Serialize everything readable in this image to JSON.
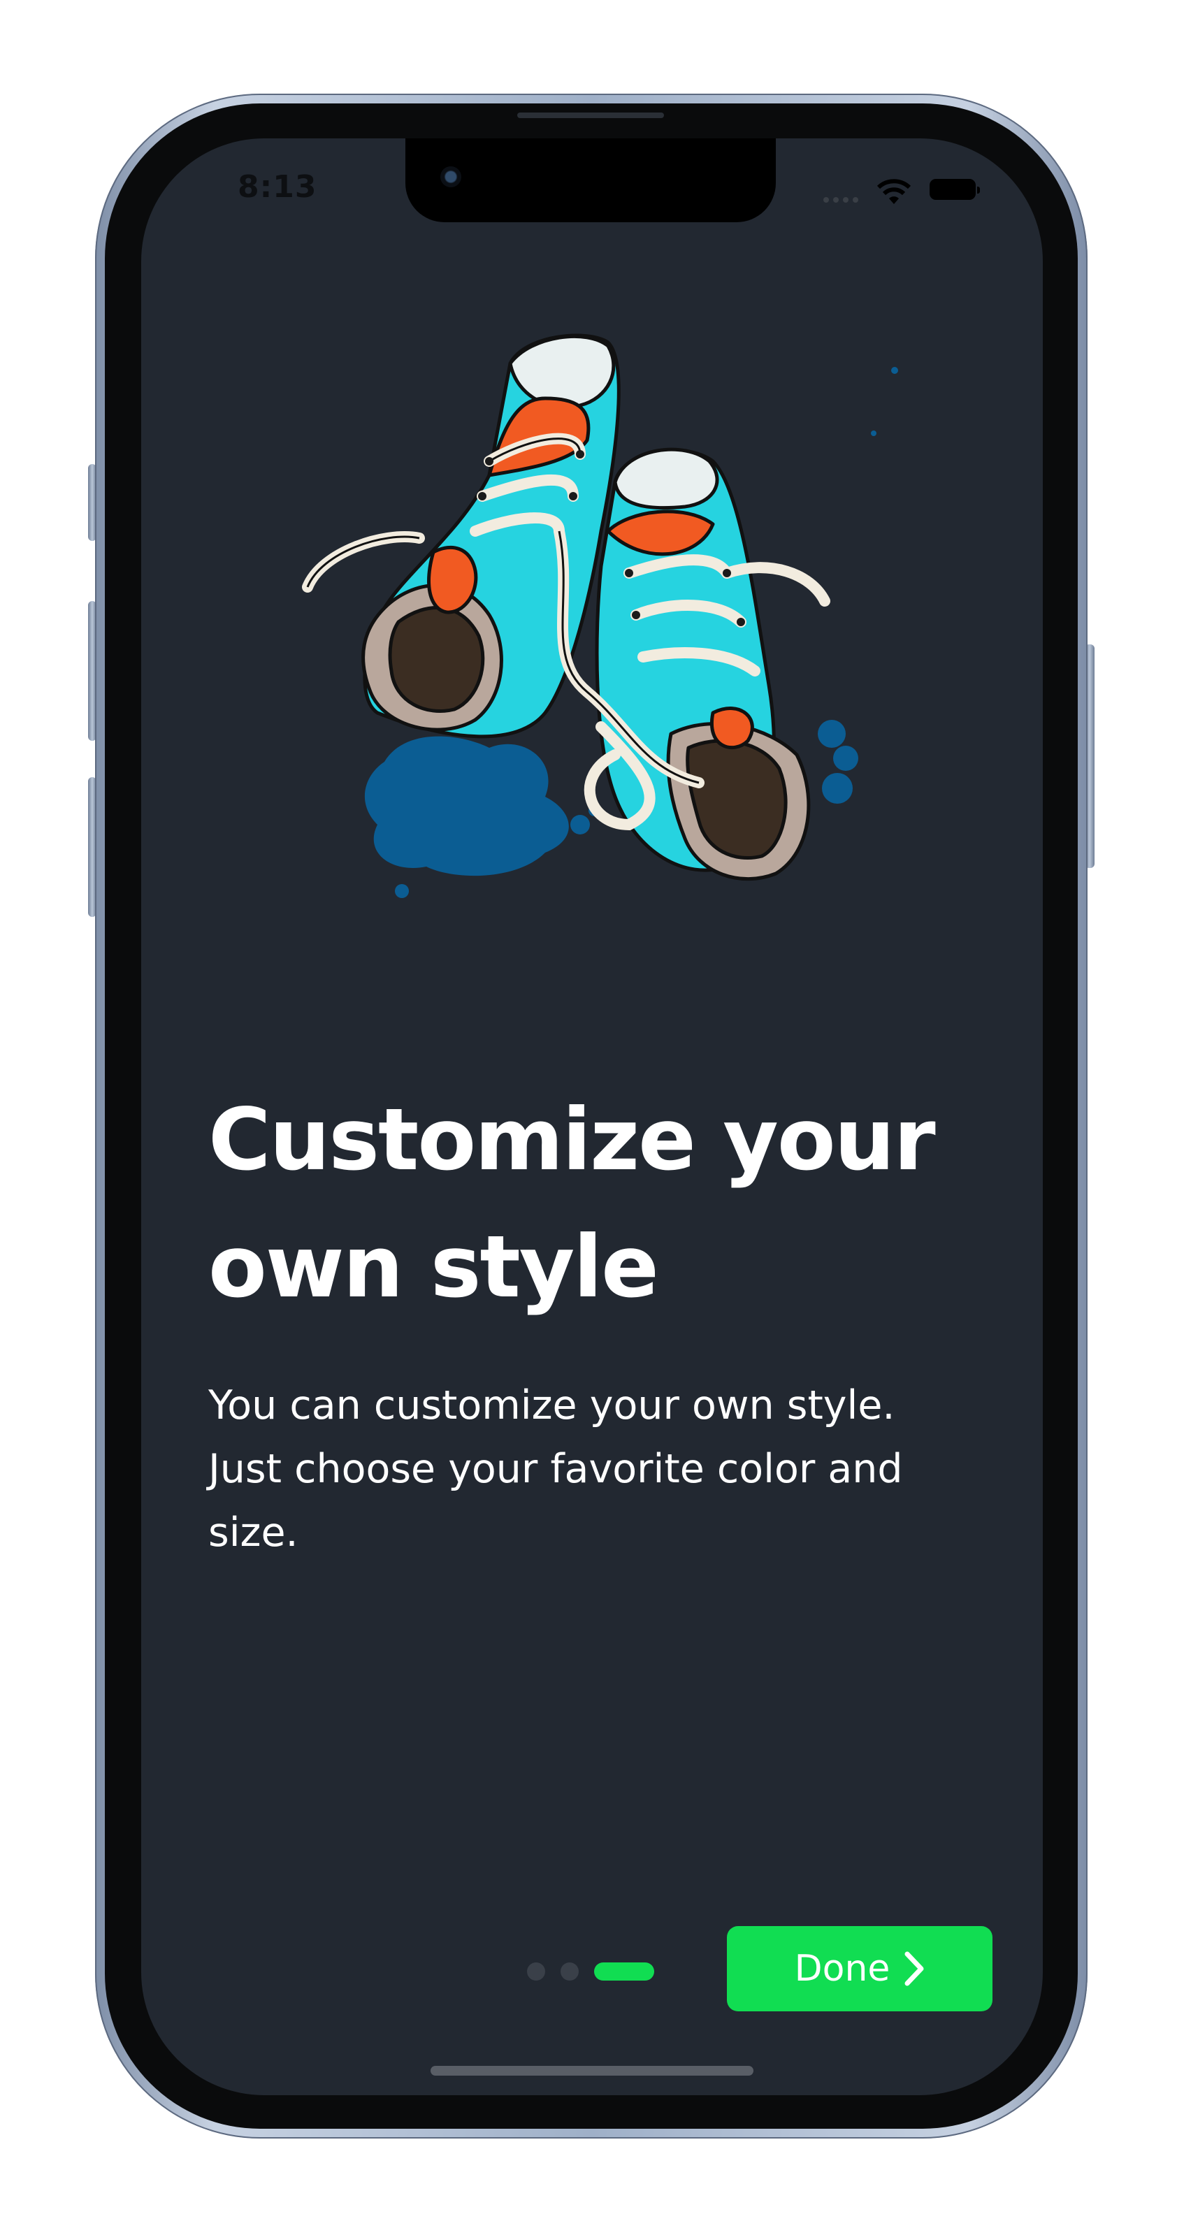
{
  "status_bar": {
    "time": "8:13"
  },
  "onboarding": {
    "title_line1": "Customize your",
    "title_line2": "own style",
    "description_line1": "You can customize your own style.",
    "description_line2": "Just choose your favorite color and",
    "description_line3": "size.",
    "page_count": 3,
    "current_page": 3,
    "done_label": "Done"
  },
  "icons": {
    "illustration": "sneakers-illustration-icon",
    "done_arrow": "chevron-right-icon"
  },
  "colors": {
    "screen_background": "#222831",
    "accent": "#11dd52",
    "text": "#ffffff",
    "shoe_cyan": "#26d3e0",
    "shoe_orange": "#f15a22",
    "ink_splash": "#0b5d93"
  }
}
